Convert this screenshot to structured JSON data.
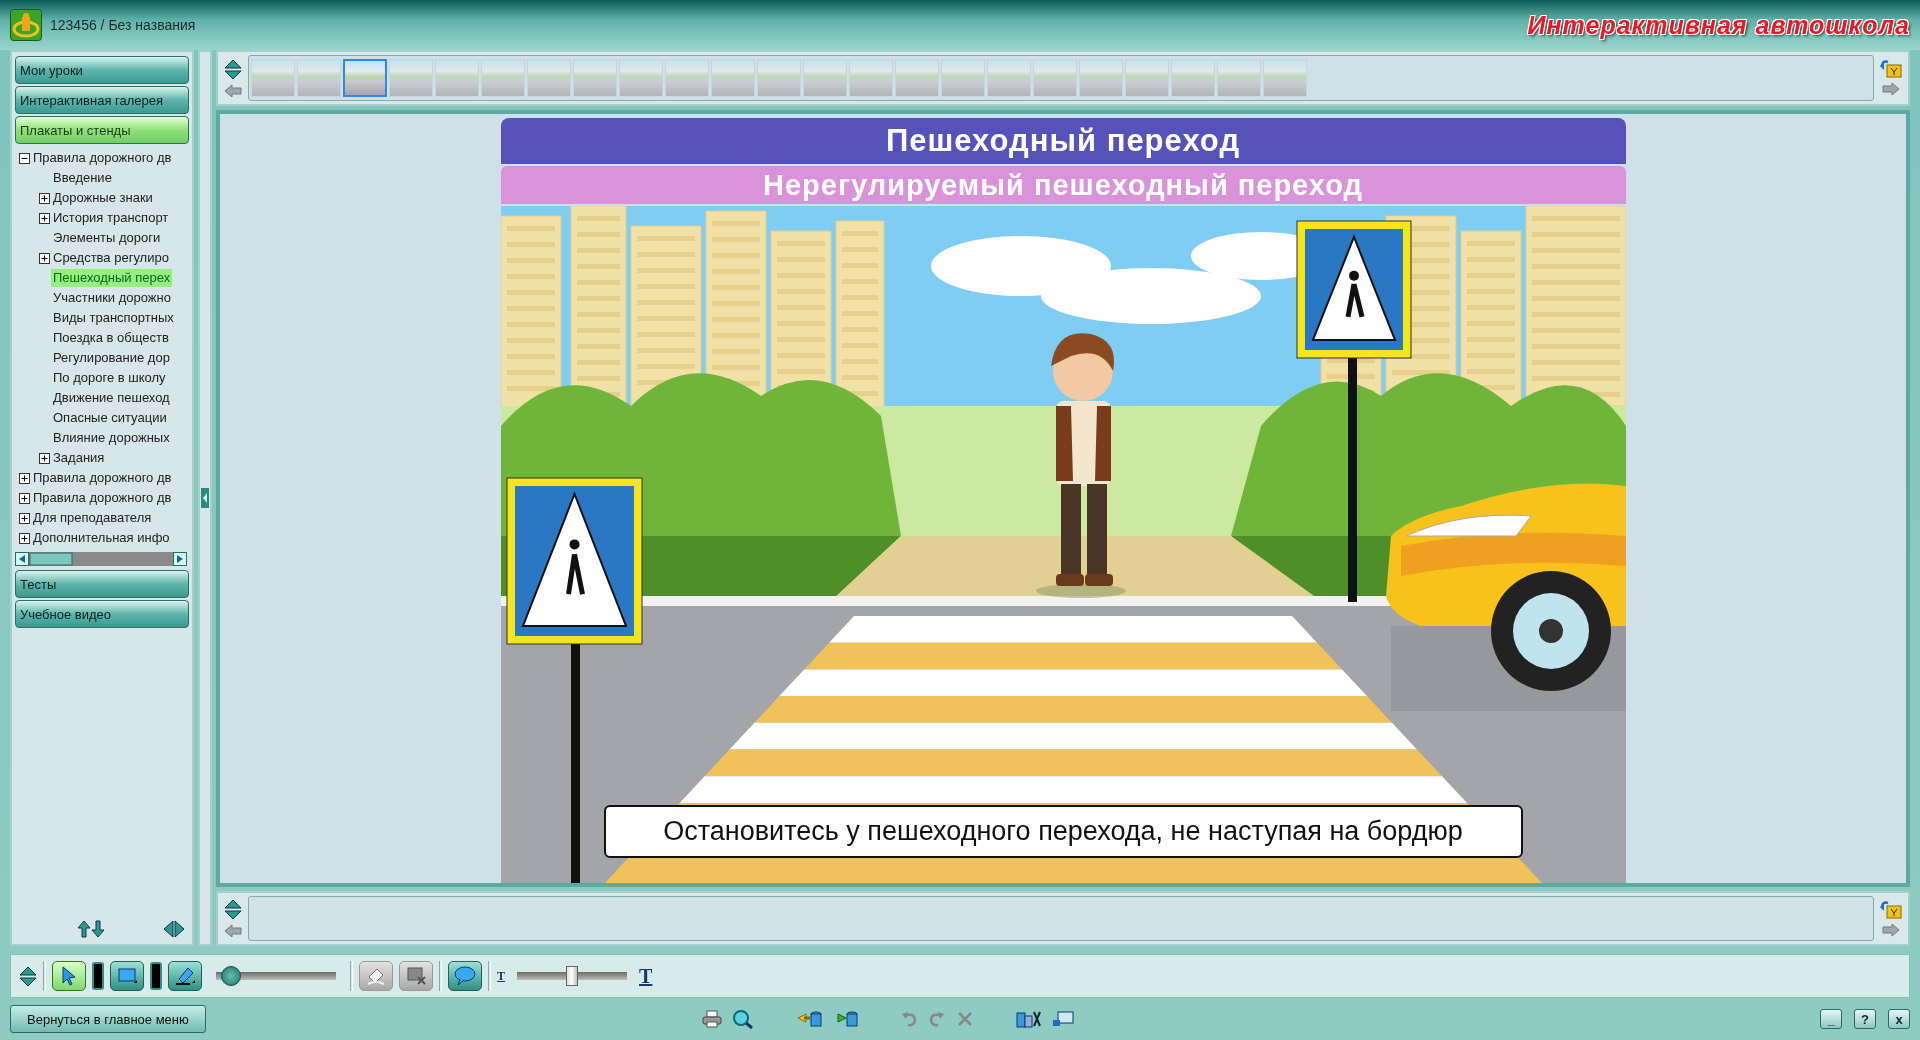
{
  "window": {
    "title": "123456 / Без названия",
    "brand": "Интерактивная автошкола"
  },
  "sidebar": {
    "top_sections": [
      {
        "label": "Мои уроки",
        "selected": false
      },
      {
        "label": "Интерактивная галерея",
        "selected": false
      },
      {
        "label": "Плакаты и стенды",
        "selected": true
      }
    ],
    "tree": [
      {
        "label": "Правила дорожного дв",
        "kind": "folder",
        "expanded": true,
        "selected": false,
        "children": [
          {
            "label": "Введение",
            "kind": "leaf",
            "selected": false
          },
          {
            "label": "Дорожные знаки",
            "kind": "folder",
            "expanded": false,
            "selected": false
          },
          {
            "label": "История транспорт",
            "kind": "folder",
            "expanded": false,
            "selected": false
          },
          {
            "label": "Элементы дороги",
            "kind": "leaf",
            "selected": false
          },
          {
            "label": "Средства регулиро",
            "kind": "folder",
            "expanded": false,
            "selected": false
          },
          {
            "label": "Пешеходный перех",
            "kind": "leaf",
            "selected": true
          },
          {
            "label": "Участники дорожно",
            "kind": "leaf",
            "selected": false
          },
          {
            "label": "Виды транспортных",
            "kind": "leaf",
            "selected": false
          },
          {
            "label": "Поездка в обществ",
            "kind": "leaf",
            "selected": false
          },
          {
            "label": "Регулирование дор",
            "kind": "leaf",
            "selected": false
          },
          {
            "label": "По дороге в школу",
            "kind": "leaf",
            "selected": false
          },
          {
            "label": "Движение пешеход",
            "kind": "leaf",
            "selected": false
          },
          {
            "label": "Опасные ситуации",
            "kind": "leaf",
            "selected": false
          },
          {
            "label": "Влияние дорожных",
            "kind": "leaf",
            "selected": false
          },
          {
            "label": "Задания",
            "kind": "folder",
            "expanded": false,
            "selected": false
          }
        ]
      },
      {
        "label": "Правила дорожного дв",
        "kind": "folder",
        "expanded": false,
        "selected": false
      },
      {
        "label": "Правила дорожного дв",
        "kind": "folder",
        "expanded": false,
        "selected": false
      },
      {
        "label": "Для преподавателя",
        "kind": "folder",
        "expanded": false,
        "selected": false
      },
      {
        "label": "Дополнительная инфо",
        "kind": "folder",
        "expanded": false,
        "selected": false
      }
    ],
    "bottom_sections": [
      {
        "label": "Тесты",
        "selected": false
      },
      {
        "label": "Учебное видео",
        "selected": false
      }
    ]
  },
  "thumbnails": [
    {
      "selected": false
    },
    {
      "selected": false
    },
    {
      "selected": true
    },
    {
      "selected": false
    },
    {
      "selected": false
    },
    {
      "selected": false
    },
    {
      "selected": false
    },
    {
      "selected": false
    },
    {
      "selected": false
    },
    {
      "selected": false
    },
    {
      "selected": false
    },
    {
      "selected": false
    },
    {
      "selected": false
    },
    {
      "selected": false
    },
    {
      "selected": false
    },
    {
      "selected": false
    },
    {
      "selected": false
    },
    {
      "selected": false
    },
    {
      "selected": false
    },
    {
      "selected": false
    },
    {
      "selected": false
    },
    {
      "selected": false
    },
    {
      "selected": false
    }
  ],
  "poster": {
    "title": "Пешеходный переход",
    "subtitle": "Нерегулируемый пешеходный переход",
    "caption": "Остановитесь у пешеходного перехода, не наступая на бордюр"
  },
  "toolbar": {
    "tools": [
      {
        "kind": "pointer",
        "selected": true,
        "disabled": false
      },
      {
        "kind": "rectangle",
        "selected": false,
        "disabled": false
      },
      {
        "kind": "highlighter",
        "selected": false,
        "disabled": false
      },
      {
        "kind": "eraser",
        "selected": false,
        "disabled": true
      },
      {
        "kind": "delete",
        "selected": false,
        "disabled": true
      },
      {
        "kind": "comment",
        "selected": false,
        "disabled": false
      }
    ],
    "brush_size": {
      "level": 0.05
    },
    "font_size": {
      "small_label": "T",
      "large_label": "T",
      "level": 0.5
    }
  },
  "status_bar": {
    "back_button": "Вернуться в главное меню",
    "window_buttons": [
      "_",
      "?",
      "x"
    ]
  }
}
